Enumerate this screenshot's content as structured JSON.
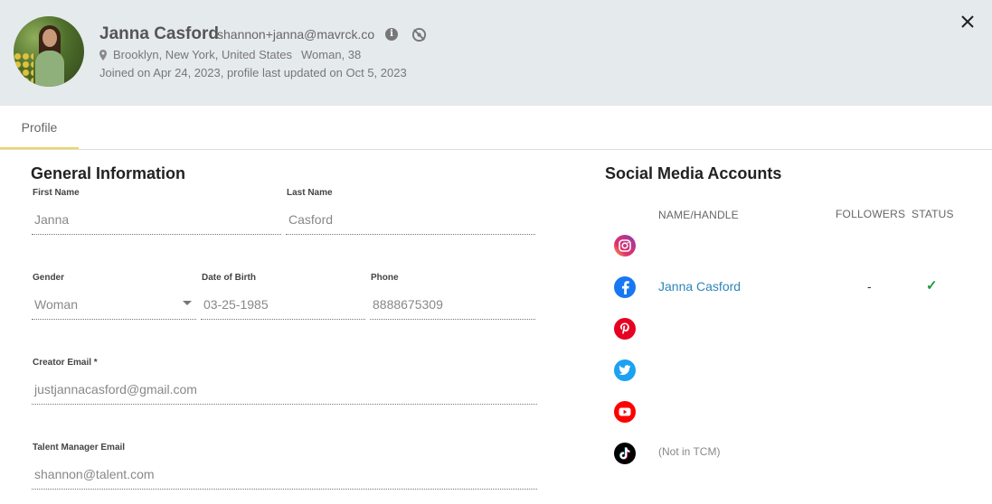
{
  "profile": {
    "name": "Janna Casford",
    "email": "shannon+janna@mavrck.co",
    "location": "Brooklyn, New York, United States",
    "demographics": "Woman, 38",
    "joined": "Joined on Apr 24, 2023, profile last updated on Oct 5, 2023"
  },
  "tabs": [
    {
      "label": "Profile"
    }
  ],
  "general": {
    "title": "General Information",
    "first_name": {
      "label": "First Name",
      "value": "Janna"
    },
    "last_name": {
      "label": "Last Name",
      "value": "Casford"
    },
    "gender": {
      "label": "Gender",
      "value": "Woman"
    },
    "dob": {
      "label": "Date of Birth",
      "value": "03-25-1985"
    },
    "phone": {
      "label": "Phone",
      "value": "8888675309"
    },
    "creator_email": {
      "label": "Creator Email *",
      "value": "justjannacasford@gmail.com"
    },
    "talent_manager_email": {
      "label": "Talent Manager Email",
      "value": "shannon@talent.com"
    }
  },
  "social": {
    "title": "Social Media Accounts",
    "columns": {
      "handle": "NAME/HANDLE",
      "followers": "FOLLOWERS",
      "status": "STATUS"
    },
    "accounts": [
      {
        "platform": "instagram-icon",
        "handle": "",
        "followers": "",
        "status": ""
      },
      {
        "platform": "facebook-icon",
        "handle": "Janna Casford",
        "followers": "-",
        "status": "✓"
      },
      {
        "platform": "pinterest-icon",
        "handle": "",
        "followers": "",
        "status": ""
      },
      {
        "platform": "twitter-icon",
        "handle": "",
        "followers": "",
        "status": ""
      },
      {
        "platform": "youtube-icon",
        "handle": "",
        "followers": "",
        "status": ""
      },
      {
        "platform": "tiktok-icon",
        "handle": "(Not in TCM)",
        "followers": "",
        "status": ""
      }
    ]
  },
  "colors": {
    "header_bg": "#e5eaed",
    "tab_underline": "#f0d45a",
    "link": "#2d86b8",
    "status_ok": "#1d9a3c"
  }
}
